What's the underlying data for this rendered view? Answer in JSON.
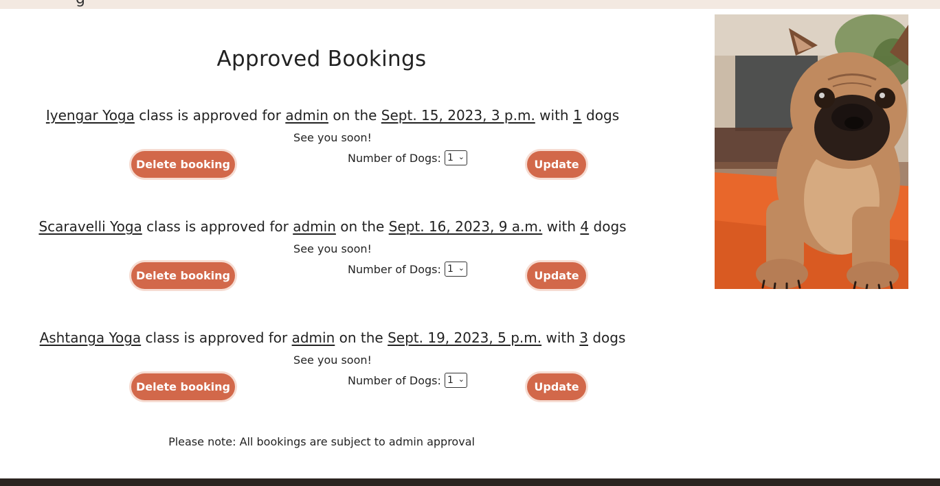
{
  "header": {
    "brand_fragment": "g"
  },
  "page_title": "Approved Bookings",
  "bookings": [
    {
      "class_name": "Iyengar Yoga",
      "approved_text": " class is approved for ",
      "user": "admin",
      "on_text": " on the ",
      "datetime": "Sept. 15, 2023, 3 p.m.",
      "with_text": " with ",
      "dogs": "1",
      "dogs_suffix": " dogs",
      "see_you": "See you soon!",
      "delete_label": "Delete booking",
      "dogs_label": "Number of Dogs:",
      "dogs_selected": "1",
      "update_label": "Update"
    },
    {
      "class_name": "Scaravelli Yoga",
      "approved_text": " class is approved for ",
      "user": "admin",
      "on_text": " on the ",
      "datetime": "Sept. 16, 2023, 9 a.m.",
      "with_text": " with ",
      "dogs": "4",
      "dogs_suffix": " dogs",
      "see_you": "See you soon!",
      "delete_label": "Delete booking",
      "dogs_label": "Number of Dogs:",
      "dogs_selected": "1",
      "update_label": "Update"
    },
    {
      "class_name": "Ashtanga Yoga",
      "approved_text": " class is approved for ",
      "user": "admin",
      "on_text": " on the ",
      "datetime": "Sept. 19, 2023, 5 p.m.",
      "with_text": " with ",
      "dogs": "3",
      "dogs_suffix": " dogs",
      "see_you": "See you soon!",
      "delete_label": "Delete booking",
      "dogs_label": "Number of Dogs:",
      "dogs_selected": "1",
      "update_label": "Update"
    }
  ],
  "note": "Please note: All bookings are subject to admin approval",
  "colors": {
    "accent": "#d2684a",
    "topbar": "#f3e9e1",
    "footer": "#2b2420"
  },
  "icons": {
    "select_chevron": "chevron-down-icon"
  }
}
